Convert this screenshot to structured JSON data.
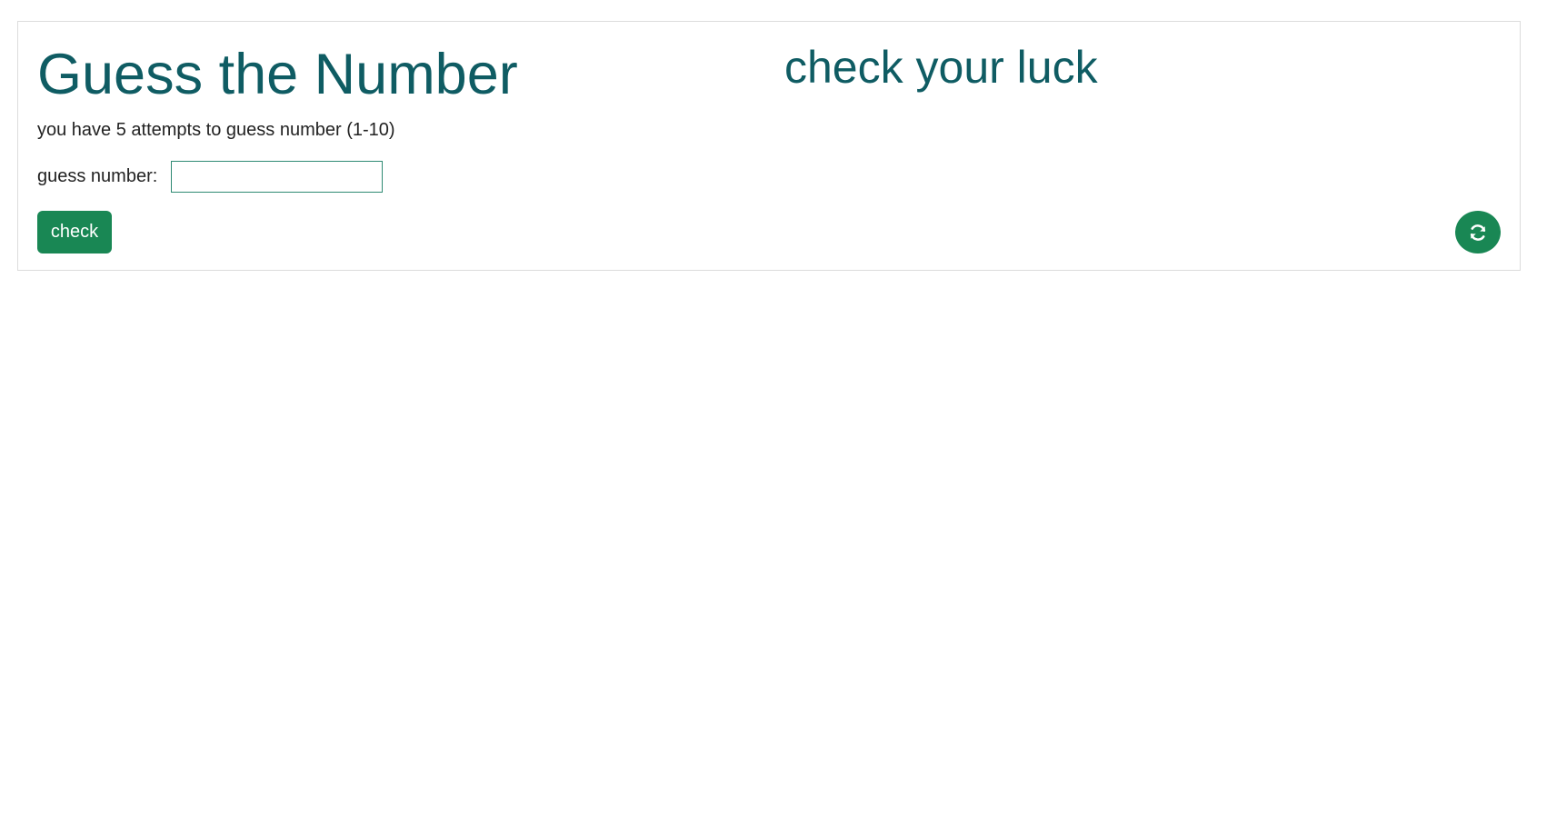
{
  "header": {
    "title": "Guess the Number",
    "tagline": "check your luck"
  },
  "game": {
    "instructions": "you have 5 attempts to guess number (1-10)",
    "guess_label": "guess number:",
    "guess_value": "",
    "check_label": "check",
    "refresh_icon": "refresh-icon"
  },
  "colors": {
    "heading": "#0f5c63",
    "accent": "#198754",
    "input_border": "#2f8a73",
    "card_border": "#dcdcdc"
  }
}
